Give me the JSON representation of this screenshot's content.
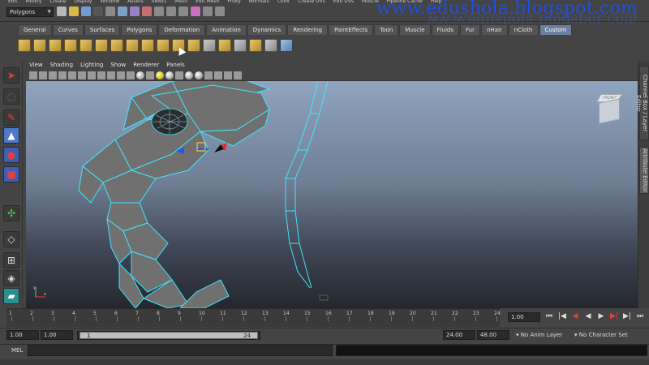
{
  "watermark": {
    "text": "www.edushola.blogspot.com"
  },
  "menu_bar": {
    "items": [
      "Edit",
      "Modify",
      "Create",
      "Display",
      "Window",
      "Assets",
      "Select",
      "Mesh",
      "Edit Mesh",
      "Proxy",
      "Normals",
      "Color",
      "Create UVs",
      "Edit UVs",
      "Muscle",
      "Pipeline Cache",
      "Help"
    ]
  },
  "mode_selector": {
    "value": "Polygons"
  },
  "shelf": {
    "tabs": [
      "General",
      "Curves",
      "Surfaces",
      "Polygons",
      "Deformation",
      "Animation",
      "Dynamics",
      "Rendering",
      "PaintEffects",
      "Toon",
      "Muscle",
      "Fluids",
      "Fur",
      "nHair",
      "nCloth",
      "Custom"
    ],
    "active_tab": "Custom"
  },
  "viewport": {
    "menus": [
      "View",
      "Shading",
      "Lighting",
      "Show",
      "Renderer",
      "Panels"
    ],
    "viewcube_label": "FRONT RIGHT",
    "axis_labels": {
      "x": "x",
      "y": "y"
    }
  },
  "right_panel": {
    "tabs": [
      "Channel Box / Layer Editor",
      "Attribute Editor"
    ]
  },
  "time_slider": {
    "ticks": [
      "1",
      "2",
      "3",
      "4",
      "5",
      "6",
      "7",
      "8",
      "9",
      "10",
      "11",
      "12",
      "13",
      "14",
      "15",
      "16",
      "17",
      "18",
      "19",
      "20",
      "21",
      "22",
      "23",
      "24"
    ],
    "current_time": "1.00"
  },
  "range_slider": {
    "start_time": "1.00",
    "playback_start": "1.00",
    "range_start_label": "1",
    "range_end_label": "24",
    "playback_end": "24.00",
    "end_time": "48.00",
    "anim_layer": "No Anim Layer",
    "character_set": "No Character Set"
  },
  "command_line": {
    "label": "MEL"
  },
  "colors": {
    "accent_tab": "#6a7fa0",
    "watermark": "#1f4fe0",
    "wire": "#3fe6ff"
  }
}
